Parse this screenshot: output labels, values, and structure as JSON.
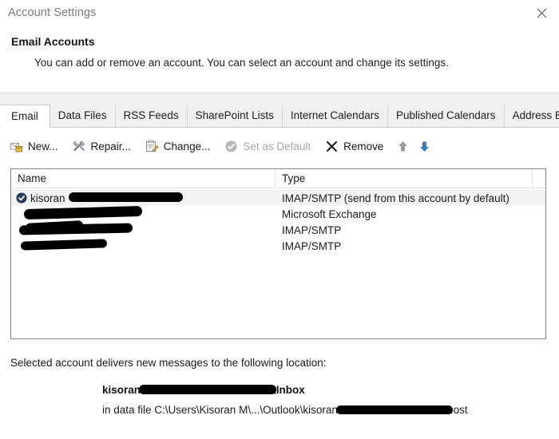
{
  "window": {
    "title": "Account Settings",
    "close_icon": "close-icon"
  },
  "header": {
    "title": "Email Accounts",
    "subtitle": "You can add or remove an account. You can select an account and change its settings."
  },
  "tabs": [
    {
      "label": "Email",
      "selected": true
    },
    {
      "label": "Data Files",
      "selected": false
    },
    {
      "label": "RSS Feeds",
      "selected": false
    },
    {
      "label": "SharePoint Lists",
      "selected": false
    },
    {
      "label": "Internet Calendars",
      "selected": false
    },
    {
      "label": "Published Calendars",
      "selected": false
    },
    {
      "label": "Address Books",
      "selected": false
    }
  ],
  "toolbar": {
    "new_label": "New...",
    "new_icon": "new-mail-icon",
    "repair_label": "Repair...",
    "repair_icon": "tools-icon",
    "change_label": "Change...",
    "change_icon": "edit-account-icon",
    "set_default_label": "Set as Default",
    "set_default_icon": "check-circle-icon",
    "set_default_disabled": true,
    "remove_label": "Remove",
    "remove_icon": "x-icon",
    "move_up_icon": "arrow-up-icon",
    "move_up_disabled": true,
    "move_down_icon": "arrow-down-icon",
    "move_down_disabled": false
  },
  "account_list": {
    "columns": [
      "Name",
      "Type"
    ],
    "rows": [
      {
        "name_visible": "kisoran",
        "name_redacted": true,
        "type": "IMAP/SMTP (send from this account by default)",
        "is_default": true,
        "selected": true
      },
      {
        "name_visible": "",
        "name_redacted": true,
        "type": "Microsoft Exchange",
        "is_default": false,
        "selected": false
      },
      {
        "name_visible": "",
        "name_redacted": true,
        "type": "IMAP/SMTP",
        "is_default": false,
        "selected": false
      },
      {
        "name_visible": "",
        "name_redacted": true,
        "type": "IMAP/SMTP",
        "is_default": false,
        "selected": false
      }
    ]
  },
  "delivery": {
    "label": "Selected account delivers new messages to the following location:",
    "inbox_prefix": "kisoran",
    "inbox_suffix": "\\Inbox",
    "file_prefix": "in data file C:\\Users\\Kisoran M\\...\\Outlook\\kisoran",
    "file_suffix": ".ost"
  },
  "colors": {
    "accent_blue": "#4a7ebb",
    "disabled_gray": "#a6a6a6",
    "selection_gray": "#f2f2f2",
    "border_gray": "#828282",
    "redaction_black": "#000000"
  }
}
